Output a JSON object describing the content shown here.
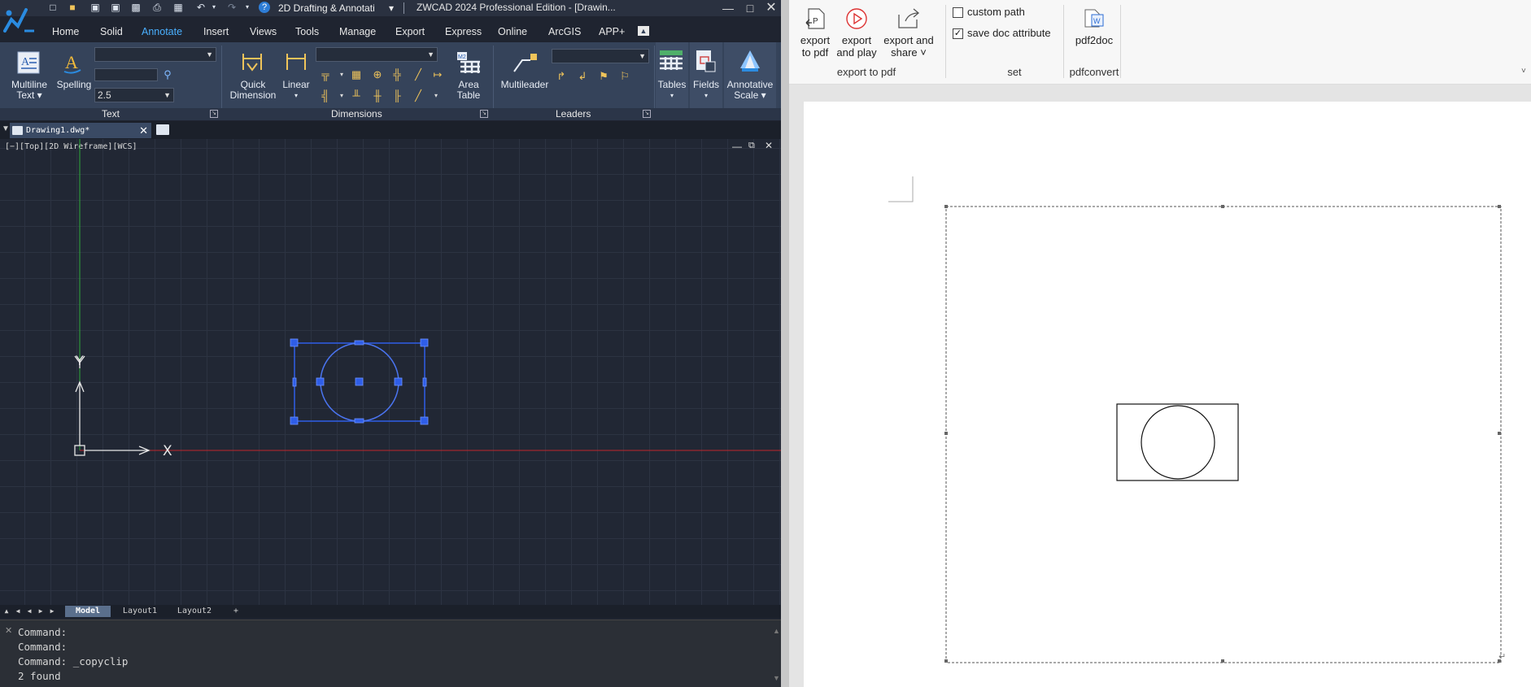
{
  "app": {
    "title": "ZWCAD 2024 Professional Edition - [Drawin...",
    "workspace": "2D Drafting & Annotati"
  },
  "menu": [
    "Home",
    "Solid",
    "Annotate",
    "Insert",
    "Views",
    "Tools",
    "Manage",
    "Export",
    "Express",
    "Online",
    "ArcGIS",
    "APP+"
  ],
  "active_menu": "Annotate",
  "ribbon": {
    "multiline_text": [
      "Multiline",
      "Text"
    ],
    "spelling": "Spelling",
    "text_height": "2.5",
    "quick_dimension": [
      "Quick",
      "Dimension"
    ],
    "linear": "Linear",
    "area_table": [
      "Area",
      "Table"
    ],
    "multileader": "Multileader",
    "tables": "Tables",
    "fields": "Fields",
    "annotative_scale": [
      "Annotative",
      "Scale"
    ],
    "panels": [
      "Text",
      "Dimensions",
      "Leaders"
    ]
  },
  "document_tab": "Drawing1.dwg*",
  "viewport_label": "[−][Top][2D Wireframe][WCS]",
  "axes": {
    "x": "X",
    "y": "Y"
  },
  "layout_tabs": [
    "Model",
    "Layout1",
    "Layout2",
    "+"
  ],
  "active_layout": "Model",
  "command_history": [
    "Command:",
    "Command:",
    "Command: _copyclip",
    "2 found"
  ],
  "pdf_ribbon": {
    "export_to_pdf": [
      "export",
      "to pdf"
    ],
    "export_and_play": [
      "export",
      "and play"
    ],
    "export_and_share": [
      "export and",
      "share ˅"
    ],
    "custom_path": "custom path",
    "custom_path_checked": false,
    "save_doc_attribute": "save doc attribute",
    "save_doc_attribute_checked": true,
    "pdf2doc": "pdf2doc",
    "groups": [
      "export to pdf",
      "set",
      "pdfconvert"
    ]
  },
  "colors": {
    "cad_bg": "#212734",
    "ribbon": "#35435a",
    "accent": "#4ab0ff",
    "selection": "#2f5ee8",
    "x_axis_red": "#c0262b",
    "y_axis_green": "#2fa83a"
  }
}
